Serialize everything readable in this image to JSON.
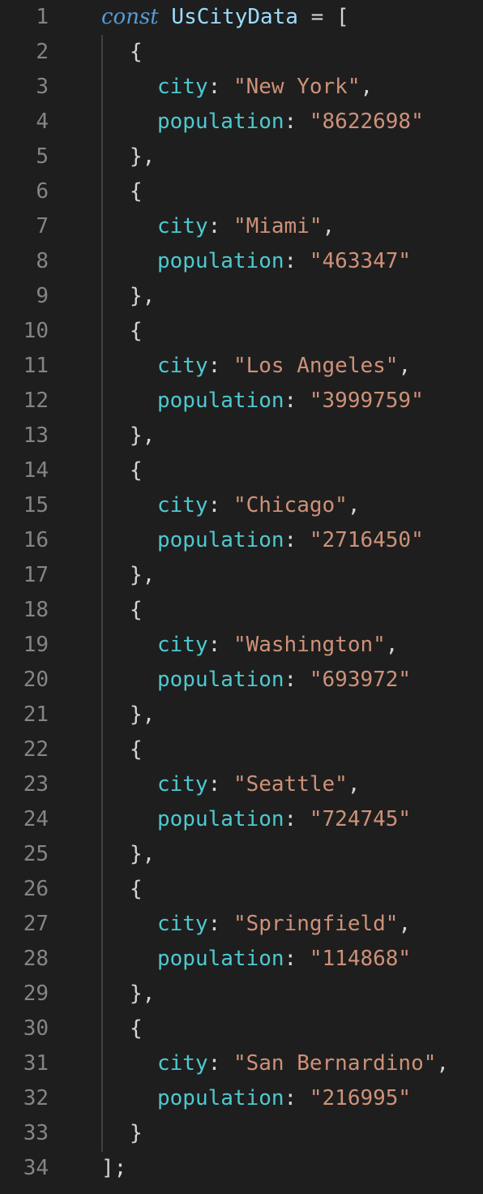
{
  "editor": {
    "line_numbers": [
      "1",
      "2",
      "3",
      "4",
      "5",
      "6",
      "7",
      "8",
      "9",
      "10",
      "11",
      "12",
      "13",
      "14",
      "15",
      "16",
      "17",
      "18",
      "19",
      "20",
      "21",
      "22",
      "23",
      "24",
      "25",
      "26",
      "27",
      "28",
      "29",
      "30",
      "31",
      "32",
      "33",
      "34"
    ],
    "declaration": {
      "keyword": "const",
      "name": "UsCityData",
      "assign": "=",
      "open": "[",
      "close": "];"
    },
    "punct": {
      "open_brace": "{",
      "close_brace_comma": "},",
      "close_brace": "}",
      "colon": ":",
      "comma": ","
    },
    "keys": {
      "city": "city",
      "population": "population"
    },
    "entries": [
      {
        "city": "\"New York\"",
        "population": "\"8622698\""
      },
      {
        "city": "\"Miami\"",
        "population": "\"463347\""
      },
      {
        "city": "\"Los Angeles\"",
        "population": "\"3999759\""
      },
      {
        "city": "\"Chicago\"",
        "population": "\"2716450\""
      },
      {
        "city": "\"Washington\"",
        "population": "\"693972\""
      },
      {
        "city": "\"Seattle\"",
        "population": "\"724745\""
      },
      {
        "city": "\"Springfield\"",
        "population": "\"114868\""
      },
      {
        "city": "\"San Bernardino\"",
        "population": "\"216995\""
      }
    ],
    "colors": {
      "background": "#1e1e1e",
      "line_number": "#858585",
      "keyword": "#569cd6",
      "variable": "#9cdcfe",
      "property": "#4ec9d0",
      "string": "#ce9178",
      "punctuation": "#d4d4d4"
    }
  }
}
